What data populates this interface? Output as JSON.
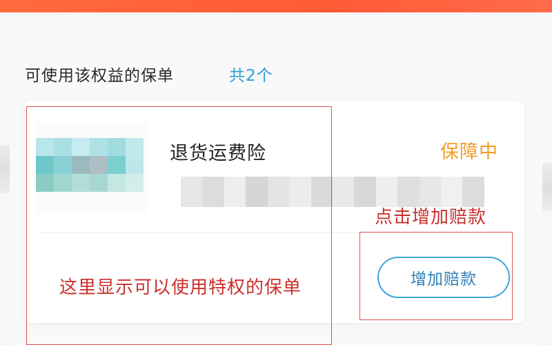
{
  "header": {
    "bar_color": "#ff5a36"
  },
  "section": {
    "title": "可使用该权益的保单",
    "count": "共2个"
  },
  "policy": {
    "name": "退货运费险",
    "status": "保障中",
    "add_claim_label": "增加赔款",
    "thumbnail_icon": "blurred-thumbnail-icon"
  },
  "annotations": {
    "click_hint": "点击增加赔款",
    "list_hint": "这里显示可以使用特权的保单"
  },
  "colors": {
    "accent_blue": "#2a9ed3",
    "status_orange": "#f39c28",
    "annotation_red": "#c9302c"
  }
}
